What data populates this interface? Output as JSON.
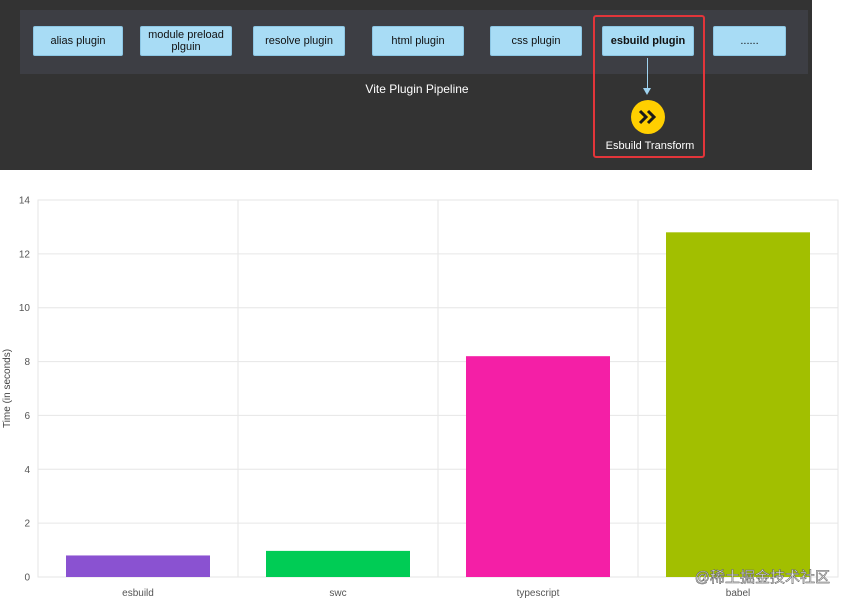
{
  "diagram": {
    "plugins": [
      {
        "label": "alias plugin",
        "bold": false
      },
      {
        "label": "module preload plguin",
        "bold": false
      },
      {
        "label": "resolve plugin",
        "bold": false
      },
      {
        "label": "html plugin",
        "bold": false
      },
      {
        "label": "css plugin",
        "bold": false
      },
      {
        "label": "esbuild plugin",
        "bold": true
      },
      {
        "label": "......",
        "bold": false
      }
    ],
    "pipeline_title": "Vite Plugin Pipeline",
    "transform_label": "Esbuild Transform",
    "logo_icon": "esbuild-double-chevron-icon",
    "colors": {
      "panel": "#333333",
      "plugin_fill": "#a8dcf5",
      "highlight": "#e2353a",
      "logo": "#ffcf00"
    }
  },
  "chart_data": {
    "type": "bar",
    "categories": [
      "esbuild",
      "swc",
      "typescript",
      "babel"
    ],
    "values": [
      0.8,
      0.97,
      8.2,
      12.8
    ],
    "colors": [
      "#8a52d1",
      "#00cc55",
      "#f41fa6",
      "#a2bf00"
    ],
    "title": "",
    "xlabel": "",
    "ylabel": "Time (in seconds)",
    "ylim": [
      0,
      14
    ],
    "yticks": [
      0,
      2,
      4,
      6,
      8,
      10,
      12,
      14
    ],
    "grid": true
  },
  "watermark": "@稀土掘金技术社区"
}
